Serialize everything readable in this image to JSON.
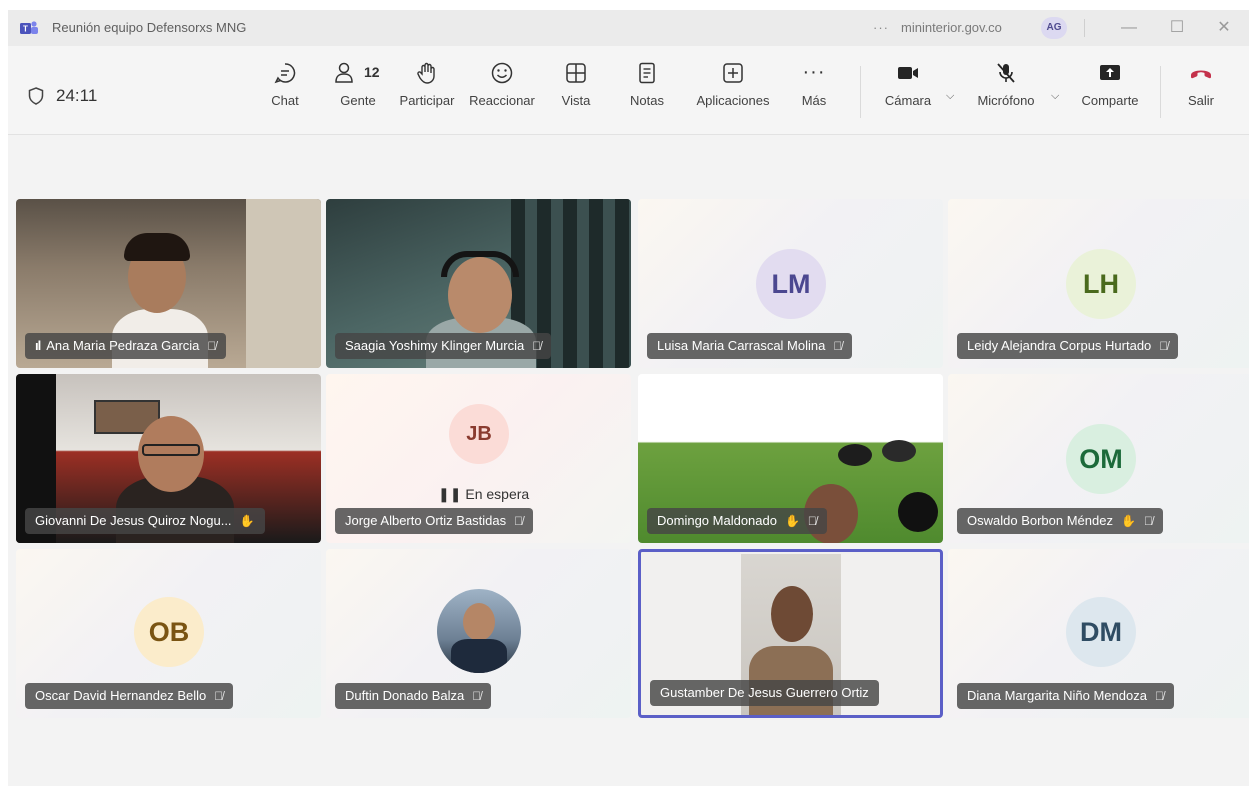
{
  "window": {
    "title": "Reunión equipo Defensorxs MNG",
    "more_glyph": "···",
    "domain": "mininterior.gov.co",
    "account_initials": "AG",
    "controls": {
      "minimize": "—",
      "maximize": "☐",
      "close": "✕"
    }
  },
  "toolbar": {
    "timer": "24:11",
    "people_count": "12",
    "buttons": {
      "chat": "Chat",
      "people": "Gente",
      "raise": "Participar",
      "react": "Reaccionar",
      "view": "Vista",
      "notes": "Notas",
      "apps": "Aplicaciones",
      "more": "Más",
      "camera": "Cámara",
      "mic": "Micrófono",
      "share": "Comparte",
      "leave": "Salir"
    },
    "more_dots": "···"
  },
  "participants": [
    {
      "name": "Ana Maria Pedraza Garcia",
      "signal": "ıl",
      "muted": true
    },
    {
      "name": "Saagia Yoshimy Klinger Murcia",
      "muted": true
    },
    {
      "name": "Luisa Maria Carrascal Molina",
      "initials": "LM",
      "muted": true
    },
    {
      "name": "Leidy Alejandra Corpus Hurtado",
      "initials": "LH",
      "muted": true
    },
    {
      "name": "Giovanni De Jesus Quiroz Nogu...",
      "muted": false
    },
    {
      "name": "Jorge Alberto Ortiz Bastidas",
      "initials": "JB",
      "status": "En espera",
      "muted": true
    },
    {
      "name": "Domingo Maldonado",
      "muted": true
    },
    {
      "name": "Oswaldo Borbon Méndez",
      "initials": "OM",
      "muted": true
    },
    {
      "name": "Oscar David Hernandez Bello",
      "initials": "OB",
      "muted": true
    },
    {
      "name": "Duftin Donado Balza",
      "muted": true
    },
    {
      "name": "Gustamber De Jesus Guerrero Ortiz",
      "muted": false
    },
    {
      "name": "Diana Margarita Niño Mendoza",
      "initials": "DM",
      "muted": true
    }
  ],
  "colors": {
    "accent": "#5b5fc7",
    "leave": "#c4314b",
    "avatar_lm": "#e2dcf0",
    "avatar_lh": "#eaf2d9",
    "avatar_jb": "#fbdcd7",
    "avatar_om": "#d9efe0",
    "avatar_ob": "#fbeccb",
    "avatar_dm": "#dde7ee"
  }
}
